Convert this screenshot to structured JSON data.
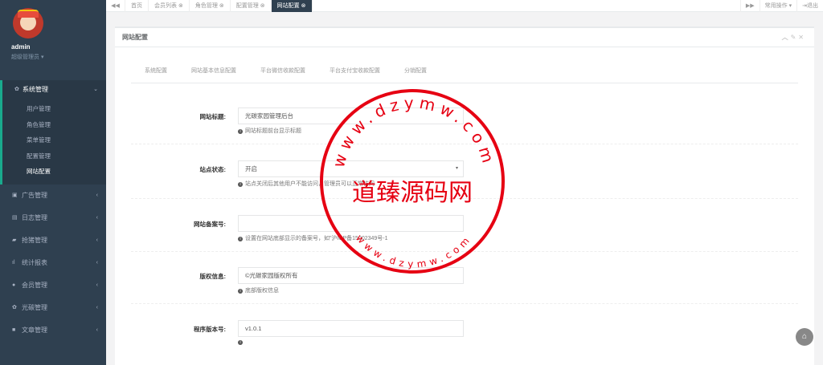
{
  "user": {
    "name": "admin",
    "role": "超级管理员"
  },
  "sidebar": {
    "active_group": "系统管理",
    "sub_items": [
      "用户管理",
      "角色管理",
      "菜单管理",
      "配置管理",
      "网站配置"
    ],
    "items": [
      "广告管理",
      "日志管理",
      "抢猪管理",
      "统计报表",
      "会员管理",
      "光碳管理",
      "文章管理"
    ]
  },
  "tabbar": {
    "tabs": [
      "首页",
      "会员列表",
      "角色管理",
      "配置管理",
      "网站配置"
    ],
    "right_ops": "常用操作",
    "logout": "退出"
  },
  "panel": {
    "title": "网站配置",
    "subtabs": [
      "系统配置",
      "网站基本信息配置",
      "平台微信收款配置",
      "平台支付宝收款配置",
      "分销配置"
    ]
  },
  "form": {
    "site_title_label": "网站标题:",
    "site_title_value": "光碳家园管理后台",
    "site_title_help": "网站标题前台显示标题",
    "status_label": "站点状态:",
    "status_value": "开启",
    "status_help": "站点关闭后其他用户不能访问，管理员可以正常访问",
    "icp_label": "网站备案号:",
    "icp_value": "",
    "icp_help": "设置在网站底部显示的备案号，如\"沪ICP备15002349号-1",
    "copyright_label": "版权信息:",
    "copyright_value": "©光碳家园版权所有",
    "copyright_help": "底部版权信息",
    "version_label": "程序版本号:",
    "version_value": "v1.0.1",
    "version_help": ""
  },
  "watermark": {
    "text": "道臻源码网",
    "url_top": "www.dzymw.com",
    "url_bottom": "www.dzymw.com"
  },
  "colors": {
    "sidebar": "#2f4050",
    "accent": "#19aa8d",
    "stamp": "#e60012"
  }
}
